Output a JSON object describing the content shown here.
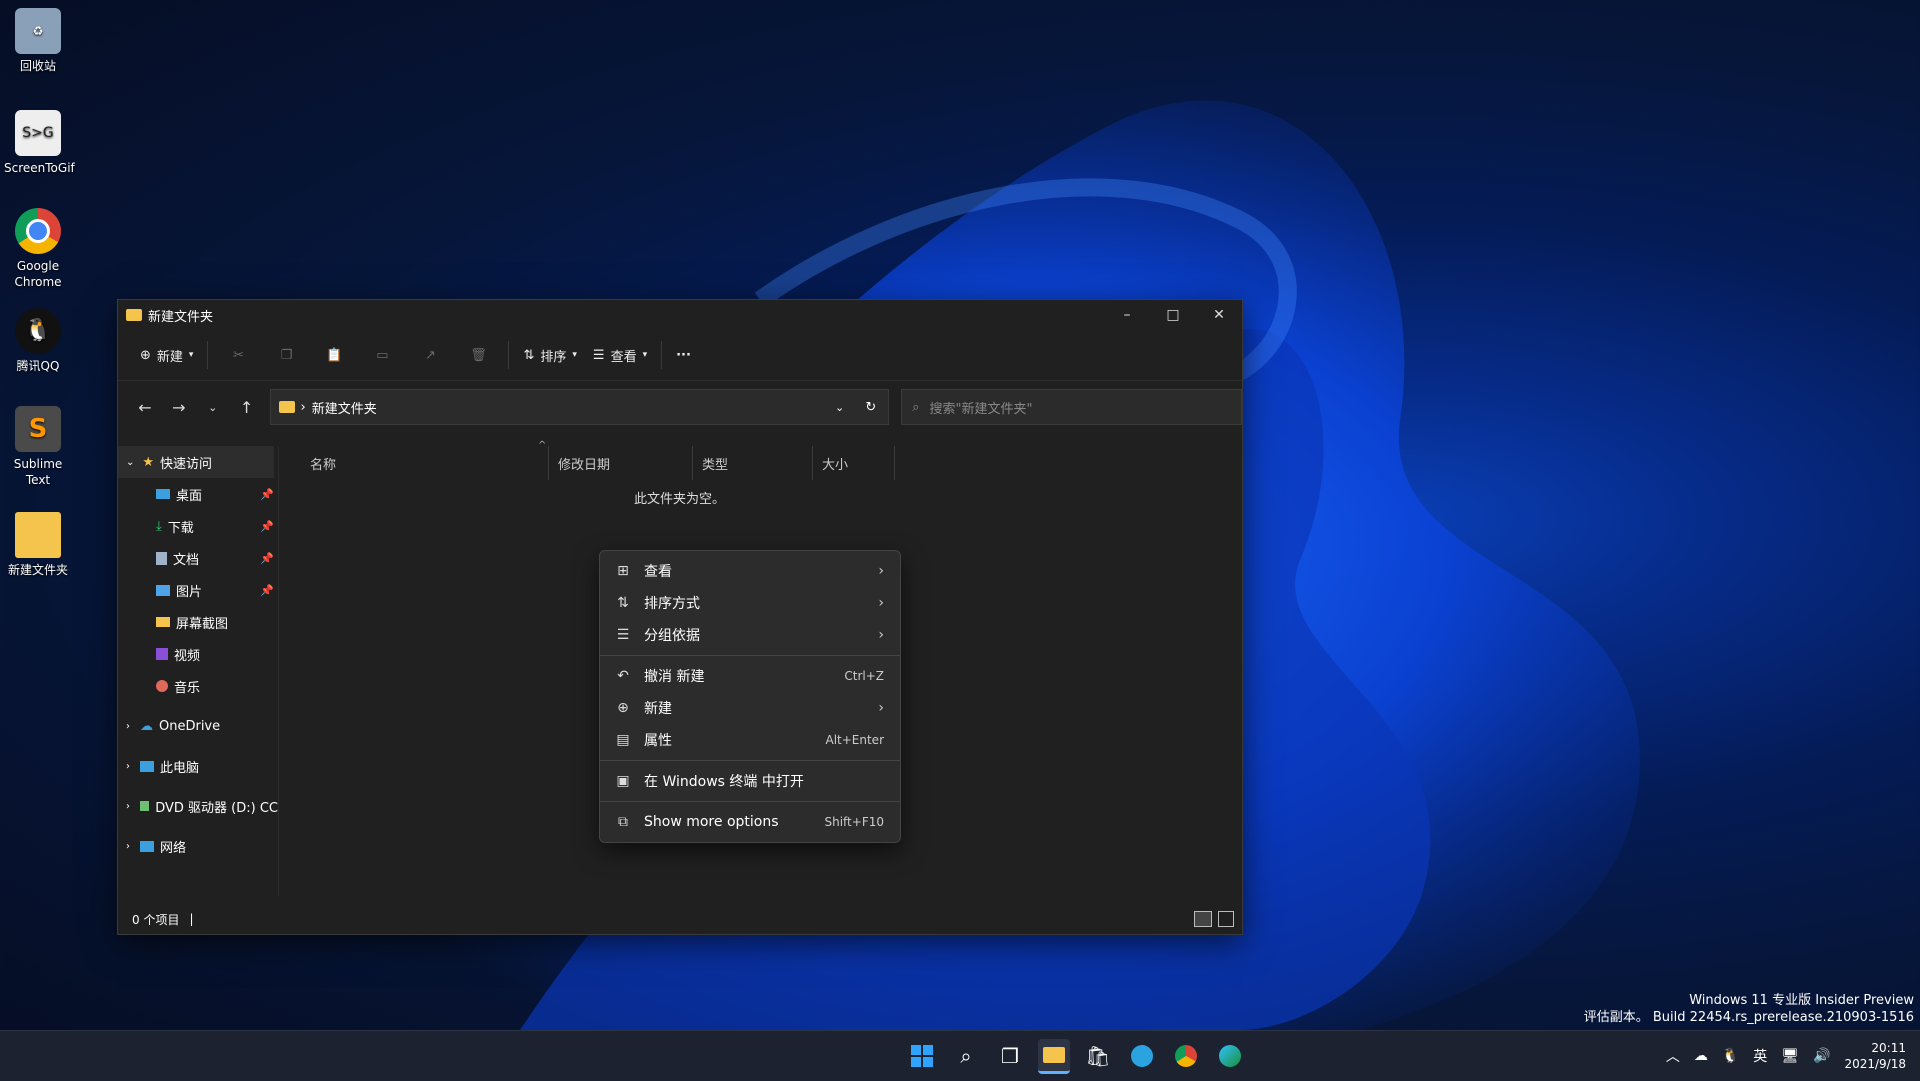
{
  "desktop": {
    "icons": [
      {
        "label": "回收站",
        "icon": "recycle-bin-icon"
      },
      {
        "label": "ScreenToGif",
        "icon": "screentogif-icon"
      },
      {
        "label": "Google Chrome",
        "icon": "chrome-icon"
      },
      {
        "label": "腾讯QQ",
        "icon": "qq-icon"
      },
      {
        "label": "Sublime Text",
        "icon": "sublime-icon"
      },
      {
        "label": "新建文件夹",
        "icon": "folder-icon"
      }
    ]
  },
  "window": {
    "title": "新建文件夹",
    "controls": {
      "minimize": "–",
      "maximize": "□",
      "close": "✕"
    },
    "commands": {
      "new": "新建",
      "sort": "排序",
      "view": "查看",
      "more": "···"
    },
    "address": {
      "path": "新建文件夹",
      "separator": "›"
    },
    "search": {
      "placeholder": "搜索\"新建文件夹\""
    },
    "sidebar": {
      "quick_access": "快速访问",
      "items": [
        {
          "label": "桌面",
          "pinned": true
        },
        {
          "label": "下载",
          "pinned": true
        },
        {
          "label": "文档",
          "pinned": true
        },
        {
          "label": "图片",
          "pinned": true
        },
        {
          "label": "屏幕截图",
          "pinned": false
        },
        {
          "label": "视频",
          "pinned": false
        },
        {
          "label": "音乐",
          "pinned": false
        }
      ],
      "onedrive": "OneDrive",
      "this_pc": "此电脑",
      "dvd": "DVD 驱动器 (D:) CC",
      "network": "网络"
    },
    "columns": [
      "名称",
      "修改日期",
      "类型",
      "大小"
    ],
    "empty_message": "此文件夹为空。",
    "status": "0 个项目"
  },
  "context_menu": {
    "items": [
      {
        "label": "查看",
        "icon": "grid-icon",
        "submenu": true
      },
      {
        "label": "排序方式",
        "icon": "sort-icon",
        "submenu": true
      },
      {
        "label": "分组依据",
        "icon": "list-icon",
        "submenu": true
      },
      {
        "label": "撤消 新建",
        "icon": "undo-icon",
        "shortcut": "Ctrl+Z"
      },
      {
        "label": "新建",
        "icon": "plus-icon",
        "submenu": true
      },
      {
        "label": "属性",
        "icon": "properties-icon",
        "shortcut": "Alt+Enter"
      },
      {
        "label": "在 Windows 终端 中打开",
        "icon": "terminal-icon"
      },
      {
        "label": "Show more options",
        "icon": "more-options-icon",
        "shortcut": "Shift+F10"
      }
    ]
  },
  "watermark": {
    "line1": "Windows 11 专业版 Insider Preview",
    "line2": "评估副本。 Build 22454.rs_prerelease.210903-1516"
  },
  "taskbar": {
    "ime": "英",
    "time": "20:11",
    "date": "2021/9/18"
  },
  "colors": {
    "accent": "#0a3fb8",
    "window_bg": "#202020",
    "menu_bg": "#2c2c2c",
    "folder": "#f4c44d"
  }
}
